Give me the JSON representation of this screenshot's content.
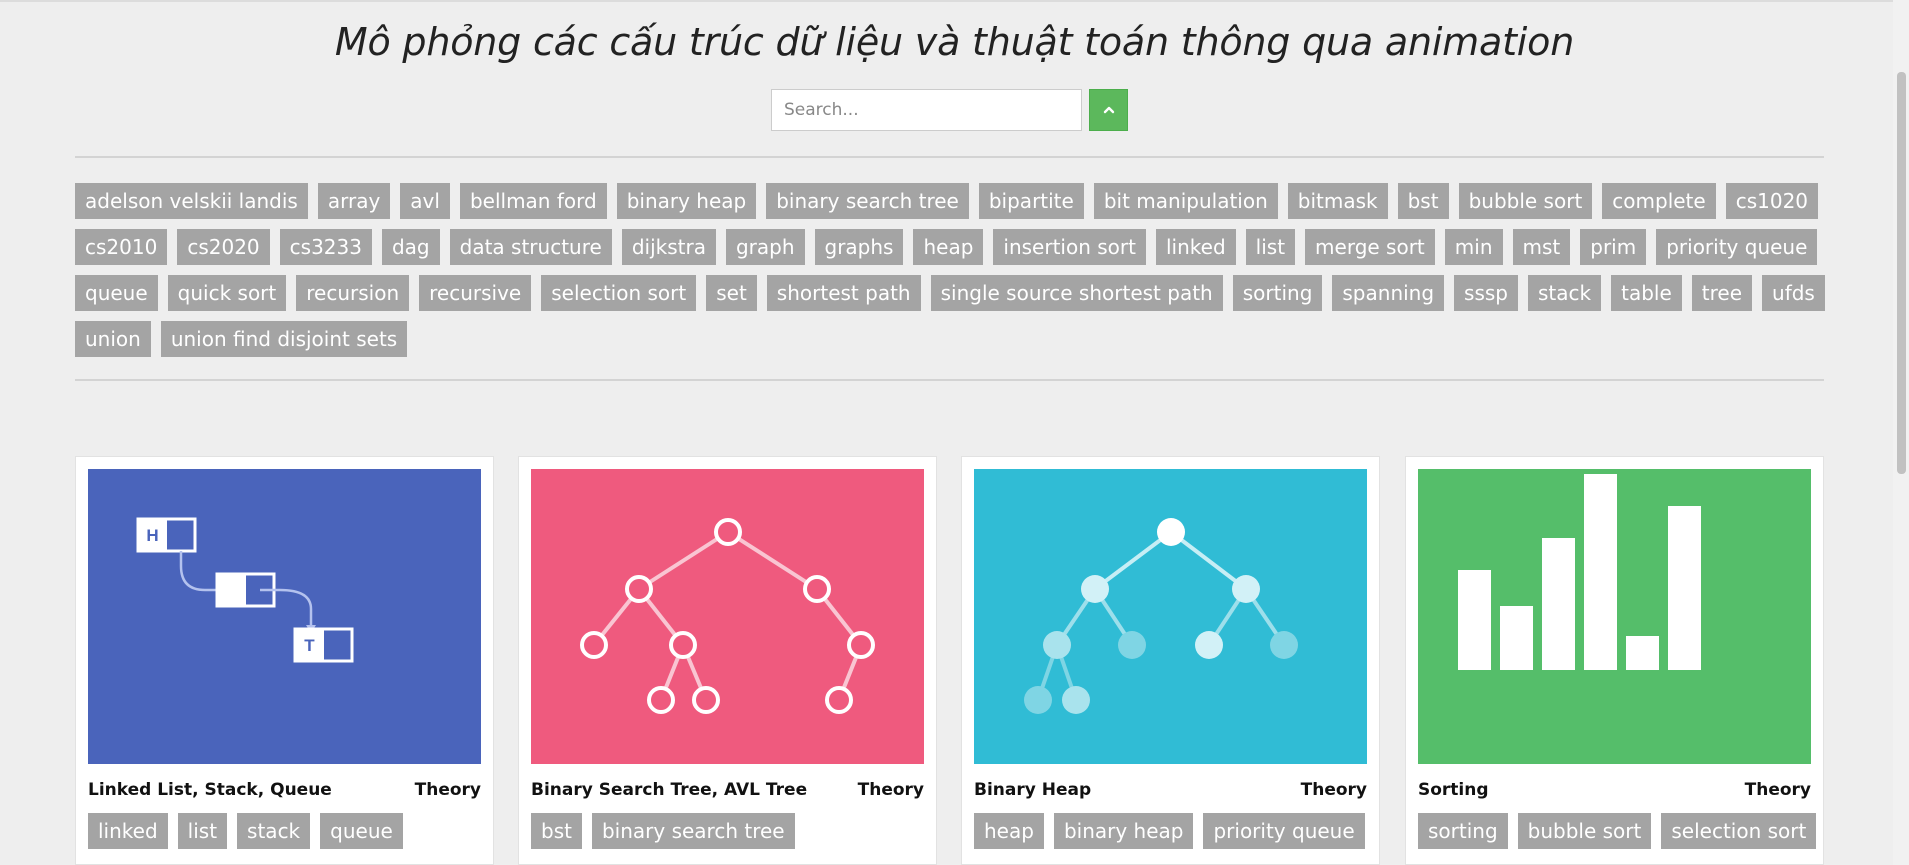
{
  "page": {
    "title": "Mô phỏng các cấu trúc dữ liệu và thuật toán thông qua animation"
  },
  "search": {
    "placeholder": "Search...",
    "value": ""
  },
  "toggle_button": {
    "icon": "chevron-up-icon",
    "color": "#5cb85c"
  },
  "tags": [
    "adelson velskii landis",
    "array",
    "avl",
    "bellman ford",
    "binary heap",
    "binary search tree",
    "bipartite",
    "bit manipulation",
    "bitmask",
    "bst",
    "bubble sort",
    "complete",
    "cs1020",
    "cs2010",
    "cs2020",
    "cs3233",
    "dag",
    "data structure",
    "dijkstra",
    "graph",
    "graphs",
    "heap",
    "insertion sort",
    "linked",
    "list",
    "merge sort",
    "min",
    "mst",
    "prim",
    "priority queue",
    "queue",
    "quick sort",
    "recursion",
    "recursive",
    "selection sort",
    "set",
    "shortest path",
    "single source shortest path",
    "sorting",
    "spanning",
    "sssp",
    "stack",
    "table",
    "tree",
    "ufds",
    "union",
    "union find disjoint sets"
  ],
  "cards": [
    {
      "title": "Linked List, Stack, Queue",
      "theory": "Theory",
      "color": "#4a64bb",
      "illustration": "linked-list-illustration",
      "node_labels": [
        "H",
        "T"
      ],
      "tags": [
        "linked",
        "list",
        "stack",
        "queue"
      ]
    },
    {
      "title": "Binary Search Tree, AVL Tree",
      "theory": "Theory",
      "color": "#ef5a7e",
      "illustration": "binary-search-tree-illustration",
      "tags": [
        "bst",
        "binary search tree"
      ]
    },
    {
      "title": "Binary Heap",
      "theory": "Theory",
      "color": "#30bcd5",
      "illustration": "binary-heap-illustration",
      "tags": [
        "heap",
        "binary heap",
        "priority queue"
      ]
    },
    {
      "title": "Sorting",
      "theory": "Theory",
      "color": "#55be6a",
      "illustration": "sorting-bars-illustration",
      "bar_heights": [
        100,
        64,
        132,
        196,
        34,
        164
      ],
      "tags": [
        "sorting",
        "bubble sort",
        "selection sort"
      ]
    }
  ]
}
